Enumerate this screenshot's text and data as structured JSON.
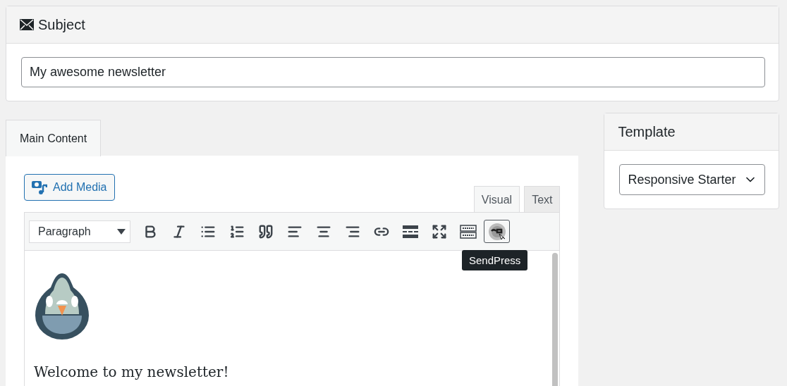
{
  "subject": {
    "title": "Subject",
    "value": "My awesome newsletter"
  },
  "content_tabs": [
    {
      "label": "Main Content",
      "selected": true
    }
  ],
  "editor": {
    "add_media": "Add Media",
    "mode_tabs": [
      {
        "label": "Visual",
        "selected": true
      },
      {
        "label": "Text",
        "selected": false
      }
    ],
    "format_select": "Paragraph",
    "toolbar": [
      {
        "kind": "bold",
        "active": false
      },
      {
        "kind": "italic",
        "active": false
      },
      {
        "kind": "bullets",
        "active": false
      },
      {
        "kind": "numbers",
        "active": false
      },
      {
        "kind": "quote",
        "active": false
      },
      {
        "kind": "align-left",
        "active": false
      },
      {
        "kind": "align-center",
        "active": false
      },
      {
        "kind": "align-right",
        "active": false
      },
      {
        "kind": "link",
        "active": false
      },
      {
        "kind": "more",
        "active": false
      },
      {
        "kind": "fullscreen",
        "active": false
      },
      {
        "kind": "keyboard",
        "active": false
      },
      {
        "kind": "sendpress",
        "active": true,
        "tooltip": "SendPress"
      }
    ],
    "body_text": "Welcome to my newsletter!"
  },
  "template": {
    "title": "Template",
    "value": "Responsive Starter"
  }
}
